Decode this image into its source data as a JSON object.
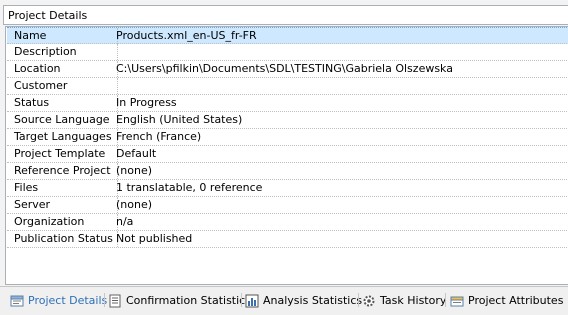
{
  "panel": {
    "title": "Project Details"
  },
  "properties": [
    {
      "label": "Name",
      "value": "Products.xml_en-US_fr-FR",
      "selected": true
    },
    {
      "label": "Description",
      "value": ""
    },
    {
      "label": "Location",
      "value": "C:\\Users\\pfilkin\\Documents\\SDL\\TESTING\\Gabriela Olszewska"
    },
    {
      "label": "Customer",
      "value": ""
    },
    {
      "label": "Status",
      "value": "In Progress"
    },
    {
      "label": "Source Language",
      "value": "English (United States)"
    },
    {
      "label": "Target Languages",
      "value": "French (France)"
    },
    {
      "label": "Project Template",
      "value": "Default"
    },
    {
      "label": "Reference Project",
      "value": "(none)"
    },
    {
      "label": "Files",
      "value": "1 translatable, 0 reference"
    },
    {
      "label": "Server",
      "value": "(none)"
    },
    {
      "label": "Organization",
      "value": "n/a"
    },
    {
      "label": "Publication Status",
      "value": "Not published"
    }
  ],
  "tabs": [
    {
      "label": "Project Details",
      "icon": "project-details-icon",
      "active": true
    },
    {
      "label": "Confirmation Statistics",
      "icon": "confirmation-statistics-icon"
    },
    {
      "label": "Analysis Statistics",
      "icon": "analysis-statistics-icon"
    },
    {
      "label": "Task History",
      "icon": "task-history-icon"
    },
    {
      "label": "Project Attributes",
      "icon": "project-attributes-icon"
    }
  ],
  "colors": {
    "selection": "#cde8ff",
    "active_tab_text": "#2f6fb8"
  }
}
